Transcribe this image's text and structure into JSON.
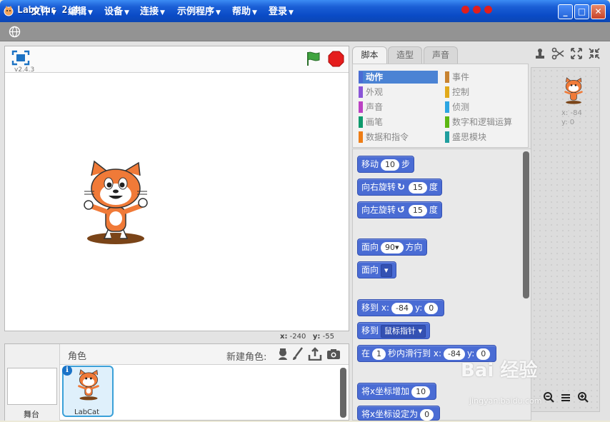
{
  "window": {
    "title": "Labplus 2.4",
    "minimize": "_",
    "maximize": "□",
    "close": "✕"
  },
  "menu": [
    {
      "label": "文件"
    },
    {
      "label": "编辑"
    },
    {
      "label": "设备"
    },
    {
      "label": "连接"
    },
    {
      "label": "示例程序"
    },
    {
      "label": "帮助"
    },
    {
      "label": "登录"
    }
  ],
  "stage": {
    "version": "v2.4.3",
    "x_label": "x:",
    "x_value": "-240",
    "y_label": "y:",
    "y_value": "-55"
  },
  "tabs": [
    {
      "label": "脚本"
    },
    {
      "label": "造型"
    },
    {
      "label": "声音"
    }
  ],
  "categories": [
    {
      "label": "动作",
      "color": "#4a6cd4"
    },
    {
      "label": "外观",
      "color": "#8a55d7"
    },
    {
      "label": "声音",
      "color": "#bb42c3"
    },
    {
      "label": "画笔",
      "color": "#0e9a6c"
    },
    {
      "label": "数据和指令",
      "color": "#ee7d16"
    },
    {
      "label": "事件",
      "color": "#c88330"
    },
    {
      "label": "控制",
      "color": "#e1a91a"
    },
    {
      "label": "侦测",
      "color": "#2ca5e2"
    },
    {
      "label": "数字和逻辑运算",
      "color": "#5cb712"
    },
    {
      "label": "盛思模块",
      "color": "#1f9e9e"
    }
  ],
  "blocks": {
    "move": {
      "label": "移动",
      "value": "10",
      "suffix": "步"
    },
    "turn_right": {
      "label": "向右旋转",
      "value": "15",
      "suffix": "度"
    },
    "turn_left": {
      "label": "向左旋转",
      "value": "15",
      "suffix": "度"
    },
    "point_dir": {
      "label": "面向",
      "value": "90",
      "suffix": "方向"
    },
    "point_towards": {
      "label": "面向"
    },
    "goto_xy": {
      "label": "移到",
      "x_label": "x:",
      "x_value": "-84",
      "y_label": "y:",
      "y_value": "0"
    },
    "goto": {
      "label": "移到",
      "option": "鼠标指针"
    },
    "glide": {
      "label": "在",
      "secs": "1",
      "mid": "秒内滑行到",
      "x_label": "x:",
      "x_value": "-84",
      "y_label": "y:",
      "y_value": "0"
    },
    "change_x": {
      "label": "将x坐标增加",
      "value": "10"
    },
    "set_x": {
      "label": "将x坐标设定为",
      "value": "0"
    }
  },
  "sprite_pane": {
    "title": "角色",
    "new_sprite": "新建角色:",
    "stage_label": "舞台",
    "sprite_name": "LabCat",
    "info": "i"
  },
  "sprite_info": {
    "x_label": "x:",
    "x_value": "-84",
    "y_label": "y:",
    "y_value": "0"
  },
  "watermark": {
    "main": "Bai 经验",
    "sub": "jingyan.baidu.com"
  }
}
